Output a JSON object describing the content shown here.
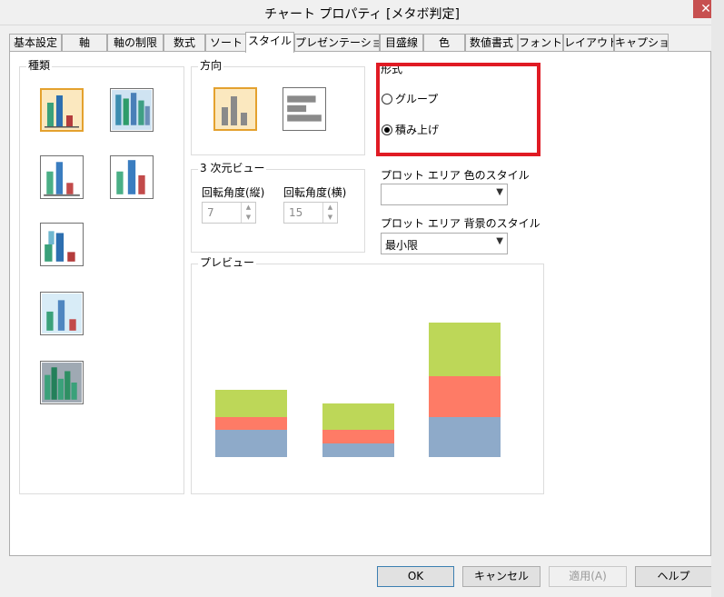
{
  "window": {
    "title": "チャート プロパティ [メタボ判定]",
    "close_glyph": "✕"
  },
  "tabs": [
    {
      "label": "基本設定"
    },
    {
      "label": "軸"
    },
    {
      "label": "軸の制限"
    },
    {
      "label": "数式"
    },
    {
      "label": "ソート"
    },
    {
      "label": "スタイル"
    },
    {
      "label": "プレゼンテーション"
    },
    {
      "label": "目盛線"
    },
    {
      "label": "色"
    },
    {
      "label": "数値書式"
    },
    {
      "label": "フォント"
    },
    {
      "label": "レイアウト"
    },
    {
      "label": "キャプション"
    }
  ],
  "active_tab": "スタイル",
  "type_group": {
    "label": "種類",
    "icons": [
      "bar-chart-flat-icon",
      "bar-chart-3d-cylinder-icon",
      "bar-chart-3d-icon",
      "bar-chart-3d-tall-icon",
      "bar-chart-3d-depth-icon",
      "bar-chart-3d-cylinder-depth-icon",
      "bar-chart-3d-cluster-icon"
    ]
  },
  "direction_group": {
    "label": "方向",
    "icons": [
      "vertical-bar-icon",
      "horizontal-bar-icon"
    ]
  },
  "style_group": {
    "label": "形式",
    "options": [
      {
        "label": "グループ",
        "checked": false
      },
      {
        "label": "積み上げ",
        "checked": true
      }
    ]
  },
  "view3d_group": {
    "label": "3 次元ビュー",
    "vertical_label": "回転角度(縦)",
    "vertical_value": "7",
    "horizontal_label": "回転角度(横)",
    "horizontal_value": "15"
  },
  "plot_color": {
    "label": "プロット エリア 色のスタイル",
    "value": ""
  },
  "plot_background": {
    "label": "プロット エリア 背景のスタイル",
    "value": "最小限"
  },
  "preview_group": {
    "label": "プレビュー",
    "stacks": [
      {
        "segments": [
          30,
          14,
          30
        ]
      },
      {
        "segments": [
          15,
          15,
          29
        ]
      },
      {
        "segments": [
          44,
          45,
          59
        ]
      }
    ],
    "colors": [
      "#8eaac9",
      "#fe7b66",
      "#bdd758"
    ]
  },
  "buttons": {
    "ok": "OK",
    "cancel": "キャンセル",
    "apply": "適用(A)",
    "help": "ヘルプ"
  }
}
